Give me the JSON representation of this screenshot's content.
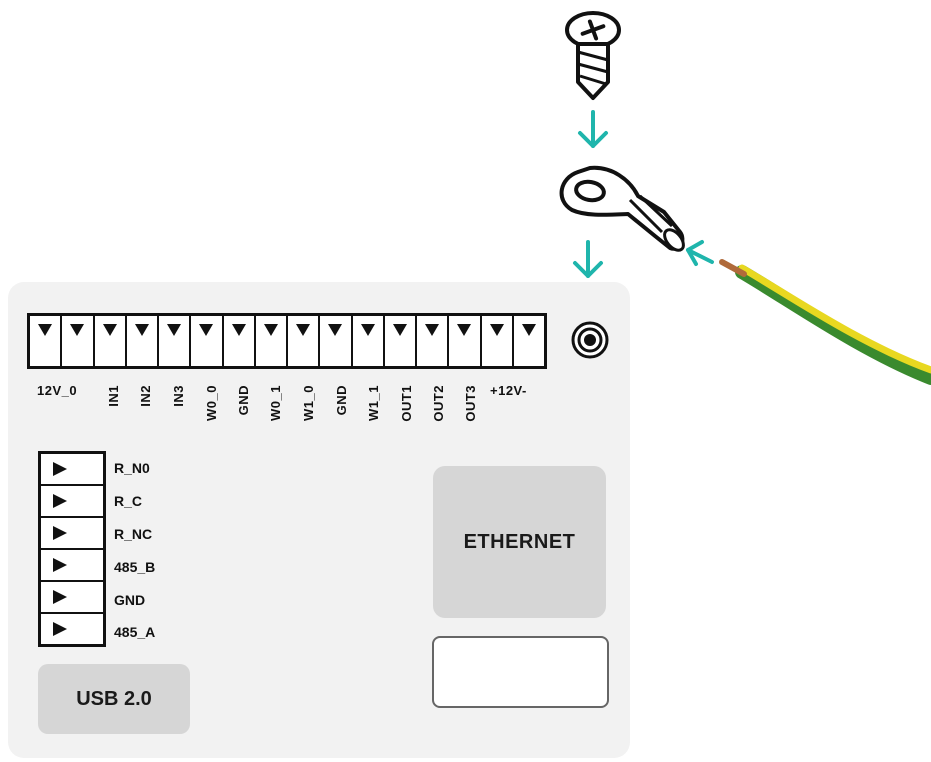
{
  "terminal_block": {
    "pins": [
      "12V_0",
      "IN1",
      "IN2",
      "IN3",
      "W0_0",
      "GND",
      "W0_1",
      "W1_0",
      "GND",
      "W1_1",
      "OUT1",
      "OUT2",
      "OUT3",
      "+12V-"
    ]
  },
  "relay_block": {
    "labels": [
      "R_N0",
      "R_C",
      "R_NC",
      "485_B",
      "GND",
      "485_A"
    ]
  },
  "ports": {
    "ethernet": "ETHERNET",
    "usb": "USB 2.0"
  },
  "colors": {
    "arrow": "#1fb5ac",
    "wire_yellow": "#e8d820",
    "wire_green": "#3a8a2e",
    "copper": "#b06a3a"
  }
}
